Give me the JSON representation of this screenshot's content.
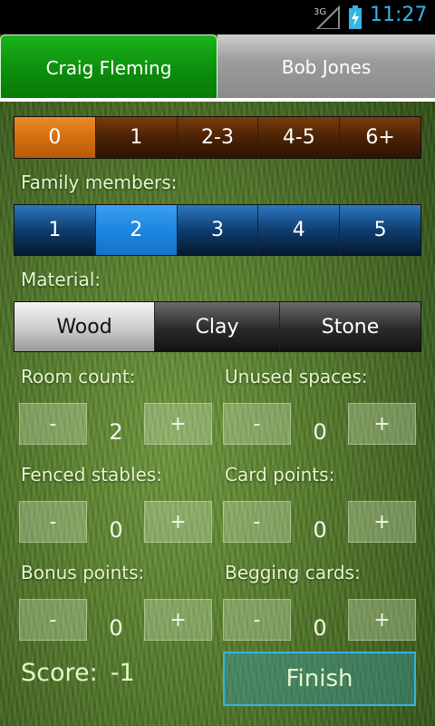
{
  "status": {
    "time": "11:27",
    "network": "3G"
  },
  "players": [
    {
      "name": "Craig Fleming",
      "active": true
    },
    {
      "name": "Bob Jones",
      "active": false
    }
  ],
  "age_options": [
    "0",
    "1",
    "2-3",
    "4-5",
    "6+"
  ],
  "age_selected": 0,
  "family": {
    "label": "Family members:",
    "options": [
      "1",
      "2",
      "3",
      "4",
      "5"
    ],
    "selected": 1
  },
  "material": {
    "label": "Material:",
    "options": [
      "Wood",
      "Clay",
      "Stone"
    ],
    "selected": 0
  },
  "counters": {
    "room_count": {
      "label": "Room count:",
      "value": "2",
      "minus": "-",
      "plus": "+"
    },
    "unused_spaces": {
      "label": "Unused spaces:",
      "value": "0",
      "minus": "-",
      "plus": "+"
    },
    "fenced_stables": {
      "label": "Fenced stables:",
      "value": "0",
      "minus": "-",
      "plus": "+"
    },
    "card_points": {
      "label": "Card points:",
      "value": "0",
      "minus": "-",
      "plus": "+"
    },
    "bonus_points": {
      "label": "Bonus points:",
      "value": "0",
      "minus": "-",
      "plus": "+"
    },
    "begging_cards": {
      "label": "Begging cards:",
      "value": "0",
      "minus": "-",
      "plus": "+"
    }
  },
  "score": {
    "label": "Score:",
    "value": "-1"
  },
  "finish_label": "Finish",
  "colors": {
    "accent": "#33b5e5",
    "tab_active": "#0a8a0a",
    "age_selected": "#d66f10",
    "family_selected": "#1c86e0"
  }
}
